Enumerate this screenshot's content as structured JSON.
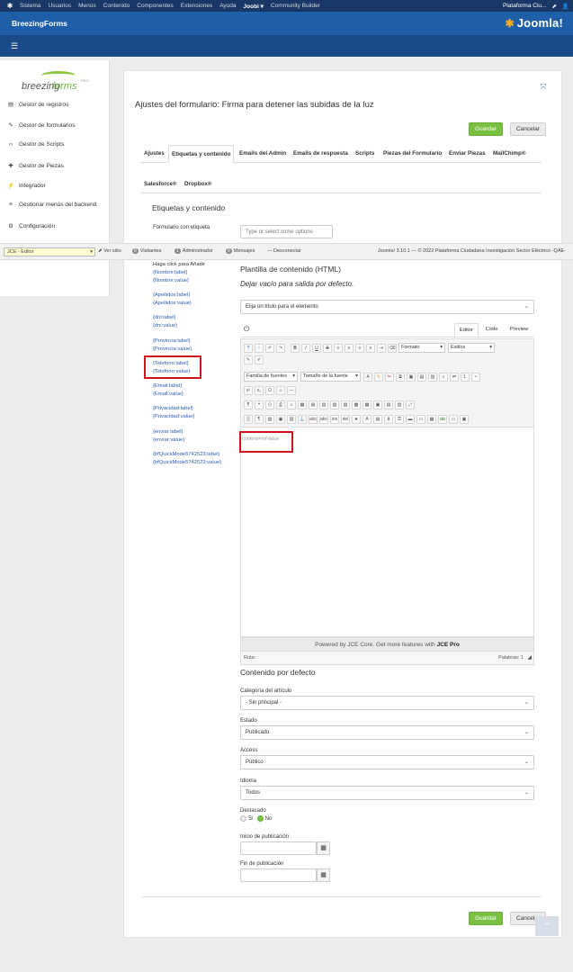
{
  "topbar": {
    "items": [
      "Sistema",
      "Usuarios",
      "Menús",
      "Contenido",
      "Componentes",
      "Extensiones",
      "Ayuda",
      "Joobi",
      "Community Builder"
    ],
    "user": "Plataforma Ciu..."
  },
  "header": {
    "app_name": "BreezingForms",
    "brand": "Joomla!"
  },
  "sidebar": {
    "logo_text_1": "breezing",
    "logo_text_2": "forms",
    "logo_pro": "PRO",
    "items": [
      {
        "label": "Gestor de registros",
        "icon": "list-icon"
      },
      {
        "label": "Gestor de formularios",
        "icon": "edit-icon"
      },
      {
        "label": "Gestor de Scripts",
        "icon": "code-icon"
      },
      {
        "label": "Gestor de Piezas",
        "icon": "puzzle-icon"
      },
      {
        "label": "Integrador",
        "icon": "plug-icon"
      },
      {
        "label": "Gestionar menús del backend",
        "icon": "menu-icon"
      },
      {
        "label": "Configuración",
        "icon": "gear-icon"
      }
    ]
  },
  "page": {
    "title": "Ajustes del formulario: Firma para detener las subidas de la luz",
    "save": "Guardar",
    "cancel": "Cancelar"
  },
  "tabs": {
    "row1": [
      "Ajustes",
      "Etiquetas y contenido",
      "Emails del Admin",
      "Emails de respuesta",
      "Scripts",
      "Piezas del Formulario",
      "Enviar Piezas",
      "MailChimp®"
    ],
    "row2": [
      "Salesforce®",
      "Dropbox®"
    ],
    "active": "Etiquetas y contenido"
  },
  "section": {
    "heading": "Etiquetas y contenido",
    "form_label_label": "Formulario con etiqueta",
    "form_label_placeholder": "Type or select some options"
  },
  "jce_bar": {
    "editor_select": "JCE - Editor",
    "view_site": "Ver sitio",
    "visitors_count": "0",
    "visitors": "Visitantes",
    "admin_count": "1",
    "admin": "Administrador",
    "messages_count": "0",
    "messages": "Mensajes",
    "logout": "Desconectar",
    "version": "Joomla! 3.10.1 — © 2022 Plataforma Ciudadana Investigación Sector Eléctrico -QAE-"
  },
  "fields": {
    "hint": "Haga click para Añadir",
    "groups": [
      [
        "{Nombre:label}",
        "{Nombre:value}"
      ],
      [
        "{Apellidos:label}",
        "{Apellidos:value}"
      ],
      [
        "{dni:label}",
        "{dni:value}"
      ],
      [
        "{Provincia:label}",
        "{Provincia:value}"
      ],
      [
        "{Telefono:label}",
        "{Telefono:value}"
      ],
      [
        "{Email:label}",
        "{Email:value}"
      ],
      [
        "{Privacidad:label}",
        "{Privacidad:value}"
      ],
      [
        "{enviar:label}",
        "{enviar:value}"
      ],
      [
        "{bfQuickMode5742523:label}",
        "{bfQuickMode5742523:value}"
      ]
    ]
  },
  "template": {
    "heading": "Plantilla de contenido (HTML)",
    "subtitle": "Dejar vacío para salida por defecto.",
    "element_select": "Elija un título para el elemento",
    "editor_tabs": [
      "Editor",
      "Code",
      "Preview"
    ],
    "format": "Formato",
    "styles": "Estilos",
    "font_family": "Familia de fuentes",
    "font_size": "Tamaño de la fuente",
    "content": "content+m/Value",
    "powered_prefix": "Powered by JCE Core. Get more features with ",
    "powered_bold": "JCE Pro",
    "path": "Ruta:",
    "words": "Palabras: 1"
  },
  "defaults": {
    "heading": "Contenido por defecto",
    "category_label": "Categoría del artículo",
    "category_value": "- Sin principal -",
    "state_label": "Estado",
    "state_value": "Publicado",
    "access_label": "Access",
    "access_value": "Público",
    "language_label": "Idioma",
    "language_value": "Todos",
    "featured_label": "Destacado",
    "featured_yes": "Sí",
    "featured_no": "No",
    "publish_start_label": "Inicio de publicación",
    "publish_end_label": "Fin de publicación"
  }
}
